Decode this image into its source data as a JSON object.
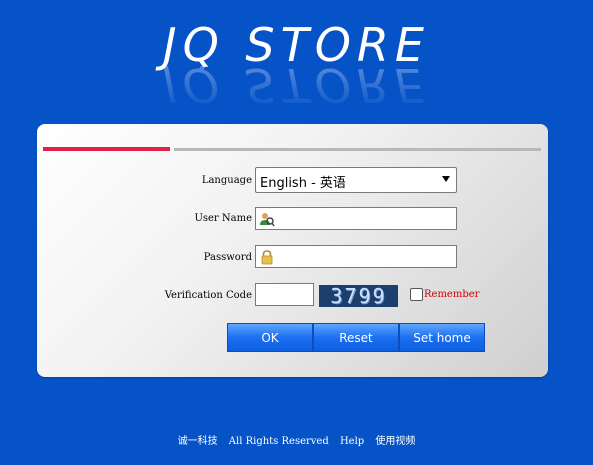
{
  "logo": {
    "text": "JQ STORE"
  },
  "form": {
    "language_label": "Language",
    "language_value": "English - 英语",
    "username_label": "User Name",
    "username_value": "",
    "password_label": "Password",
    "password_value": "",
    "verification_label": "Verification Code",
    "verification_value": "",
    "captcha_text": "3799",
    "remember_label": "Remember",
    "remember_checked": false
  },
  "buttons": {
    "ok": "OK",
    "reset": "Reset",
    "set_home": "Set home"
  },
  "footer": {
    "company": "诚一科技",
    "rights": "All Rights Reserved",
    "help": "Help",
    "video": "使用视频"
  },
  "colors": {
    "background": "#0653c8",
    "accent_bar": "#e3204a",
    "remember_text": "#d00000",
    "button": "#1c6ff0"
  },
  "icons": {
    "username": "user-icon",
    "password": "lock-icon",
    "dropdown": "chevron-down-icon"
  }
}
